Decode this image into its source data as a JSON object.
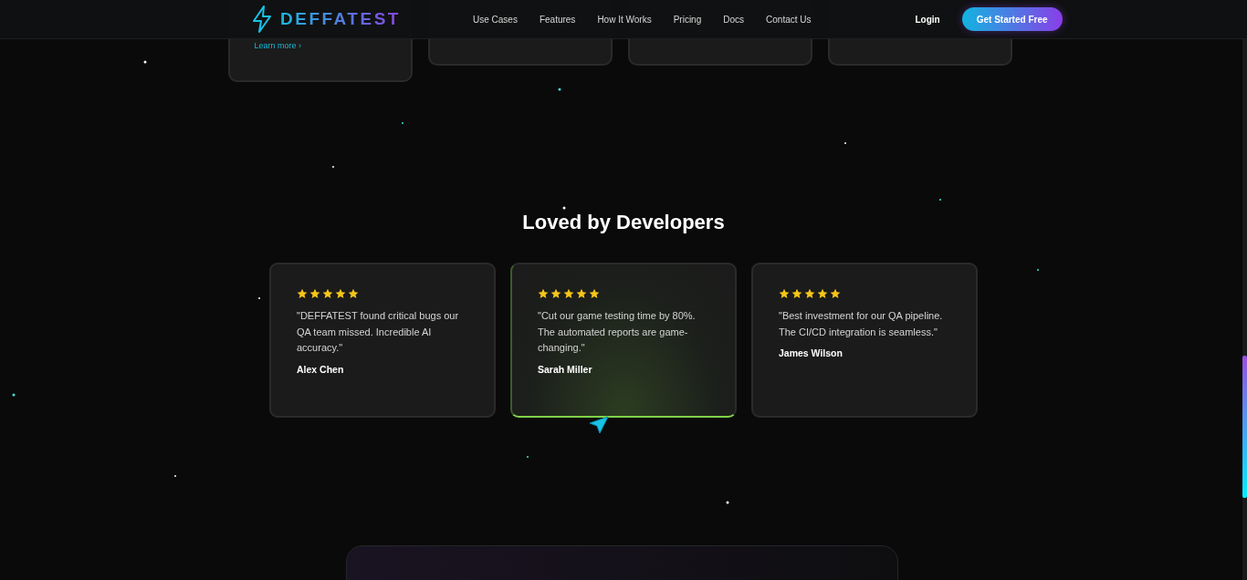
{
  "header": {
    "logo": "DEFFATEST",
    "nav": [
      {
        "label": "Use Cases"
      },
      {
        "label": "Features"
      },
      {
        "label": "How It Works"
      },
      {
        "label": "Pricing"
      },
      {
        "label": "Docs"
      },
      {
        "label": "Contact Us"
      }
    ],
    "login": "Login",
    "cta": "Get Started Free"
  },
  "feature_cards": [
    {
      "kind": "link",
      "link": "Learn more ›"
    },
    {
      "kind": "plain"
    },
    {
      "kind": "plain"
    },
    {
      "kind": "plain"
    }
  ],
  "testimonials": {
    "title": "Loved by Developers",
    "items": [
      {
        "stars": 5,
        "quote": "\"DEFFATEST found critical bugs our QA team missed. Incredible AI accuracy.\"",
        "author": "Alex Chen",
        "highlighted": false
      },
      {
        "stars": 5,
        "quote": "\"Cut our game testing time by 80%. The automated reports are game-changing.\"",
        "author": "Sarah Miller",
        "highlighted": true
      },
      {
        "stars": 5,
        "quote": "\"Best investment for our QA pipeline. The CI/CD integration is seamless.\"",
        "author": "James Wilson",
        "highlighted": false
      }
    ]
  }
}
